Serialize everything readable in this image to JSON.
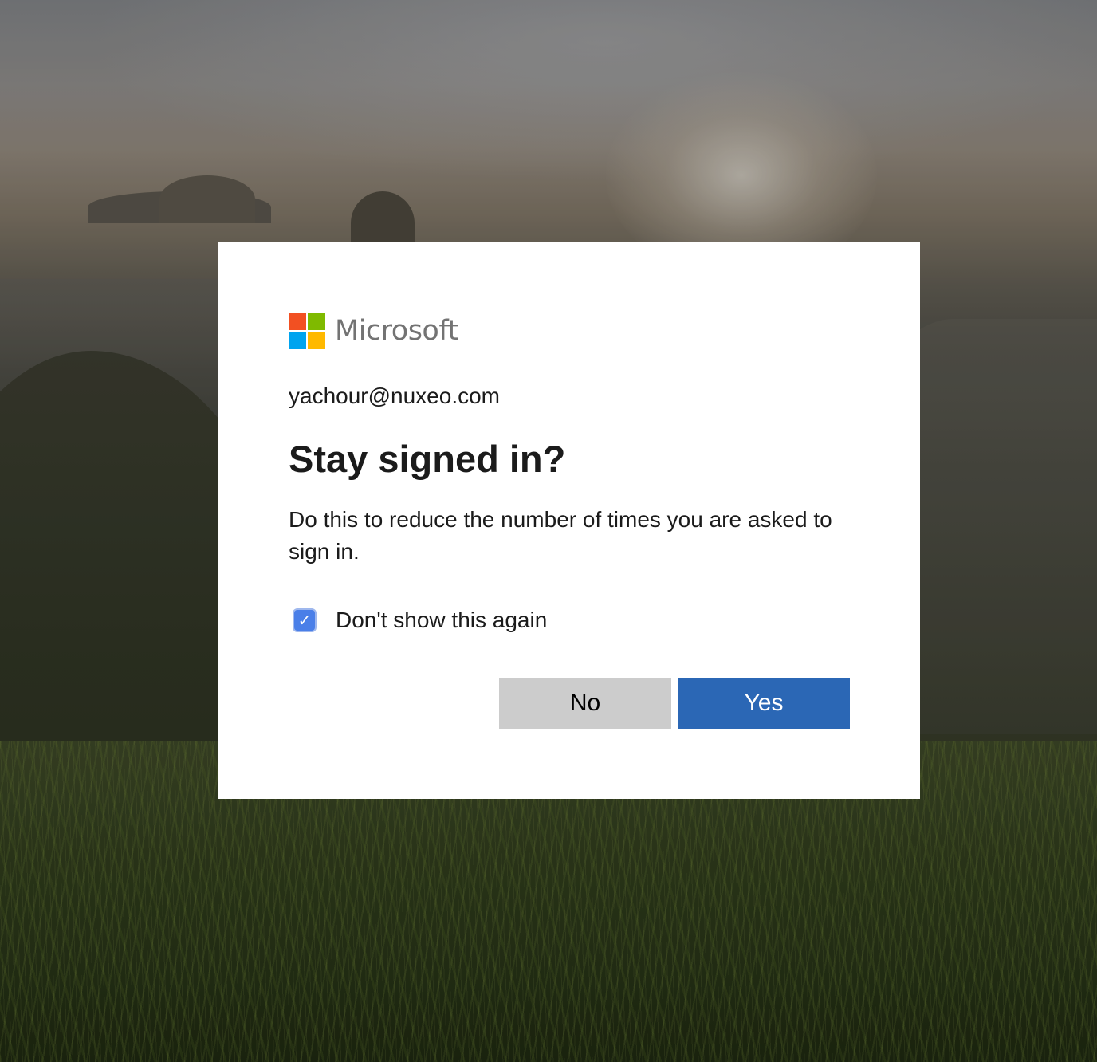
{
  "brand": {
    "name": "Microsoft",
    "logo_colors": [
      "#f25022",
      "#7fba00",
      "#00a4ef",
      "#ffb900"
    ]
  },
  "account": {
    "email": "yachour@nuxeo.com"
  },
  "prompt": {
    "title": "Stay signed in?",
    "description": "Do this to reduce the number of times you are asked to sign in."
  },
  "checkbox": {
    "label": "Don't show this again",
    "checked": true,
    "check_glyph": "✓"
  },
  "buttons": {
    "no_label": "No",
    "yes_label": "Yes"
  },
  "colors": {
    "primary": "#2b67b5",
    "secondary": "#cccccc",
    "checkbox": "#4a7fe8"
  },
  "icons": {
    "logo": "microsoft-logo-icon",
    "check": "checkmark-icon"
  }
}
